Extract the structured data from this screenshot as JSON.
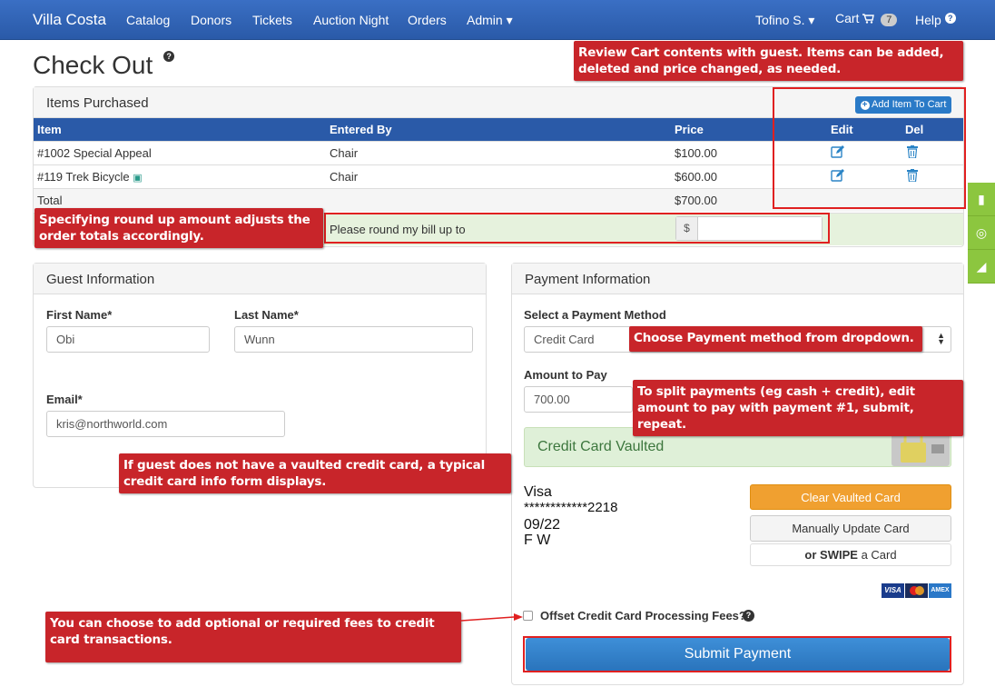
{
  "nav": {
    "brand": "Villa Costa",
    "items": [
      "Catalog",
      "Donors",
      "Tickets",
      "Auction Night",
      "Orders",
      "Admin ▾"
    ],
    "user": "Tofino S. ▾",
    "cart_label": "Cart",
    "cart_count": "7",
    "help": "Help"
  },
  "page": {
    "title": "Check Out"
  },
  "items_panel": {
    "heading": "Items Purchased",
    "add_button": "Add Item To Cart",
    "columns": [
      "Item",
      "Entered By",
      "Price",
      "Edit",
      "Del"
    ],
    "rows": [
      {
        "item": "#1002 Special Appeal",
        "entered_by": "Chair",
        "price": "$100.00"
      },
      {
        "item": "#119 Trek Bicycle",
        "entered_by": "Chair",
        "price": "$600.00"
      }
    ],
    "total_label": "Total",
    "total_value": "$700.00",
    "round_label": "Please round my bill up to",
    "round_prefix": "$",
    "round_value": ""
  },
  "guest": {
    "heading": "Guest Information",
    "first_name_label": "First Name*",
    "first_name": "Obi",
    "last_name_label": "Last Name*",
    "last_name": "Wunn",
    "email_label": "Email*",
    "email": "kris@northworld.com"
  },
  "payment": {
    "heading": "Payment Information",
    "method_label": "Select a Payment Method",
    "method_value": "Credit Card",
    "amount_label": "Amount to Pay",
    "amount_value": "700.00",
    "vaulted_label": "Credit Card Vaulted",
    "card_brand": "Visa",
    "card_number": "************2218",
    "card_exp": "09/22",
    "card_name": "F W",
    "clear_button": "Clear Vaulted Card",
    "update_button": "Manually Update Card",
    "swipe_prefix": "or",
    "swipe_bold": "SWIPE",
    "swipe_suffix": "a Card",
    "card_logos": [
      "VISA",
      "MC",
      "AMEX"
    ],
    "offset_label": "Offset Credit Card Processing Fees?",
    "submit_button": "Submit Payment"
  },
  "callouts": {
    "cart": "Review Cart contents with guest.  Items can be added, deleted and price changed, as needed.",
    "roundup": "Specifying round up amount adjusts the order totals accordingly.",
    "method": "Choose Payment method from dropdown.",
    "split": "To split payments (eg cash + credit), edit amount to pay with payment #1, submit, repeat.",
    "vault": "If guest does not have a vaulted credit card, a typical credit card info form displays.",
    "fees": "You can choose to add optional or required fees to credit card transactions."
  },
  "colors": {
    "nav": "#2a5aa8",
    "accent": "#c8252a",
    "success_bg": "#e6f2dd",
    "warning": "#f0a030",
    "side_tab": "#8cc63f"
  }
}
